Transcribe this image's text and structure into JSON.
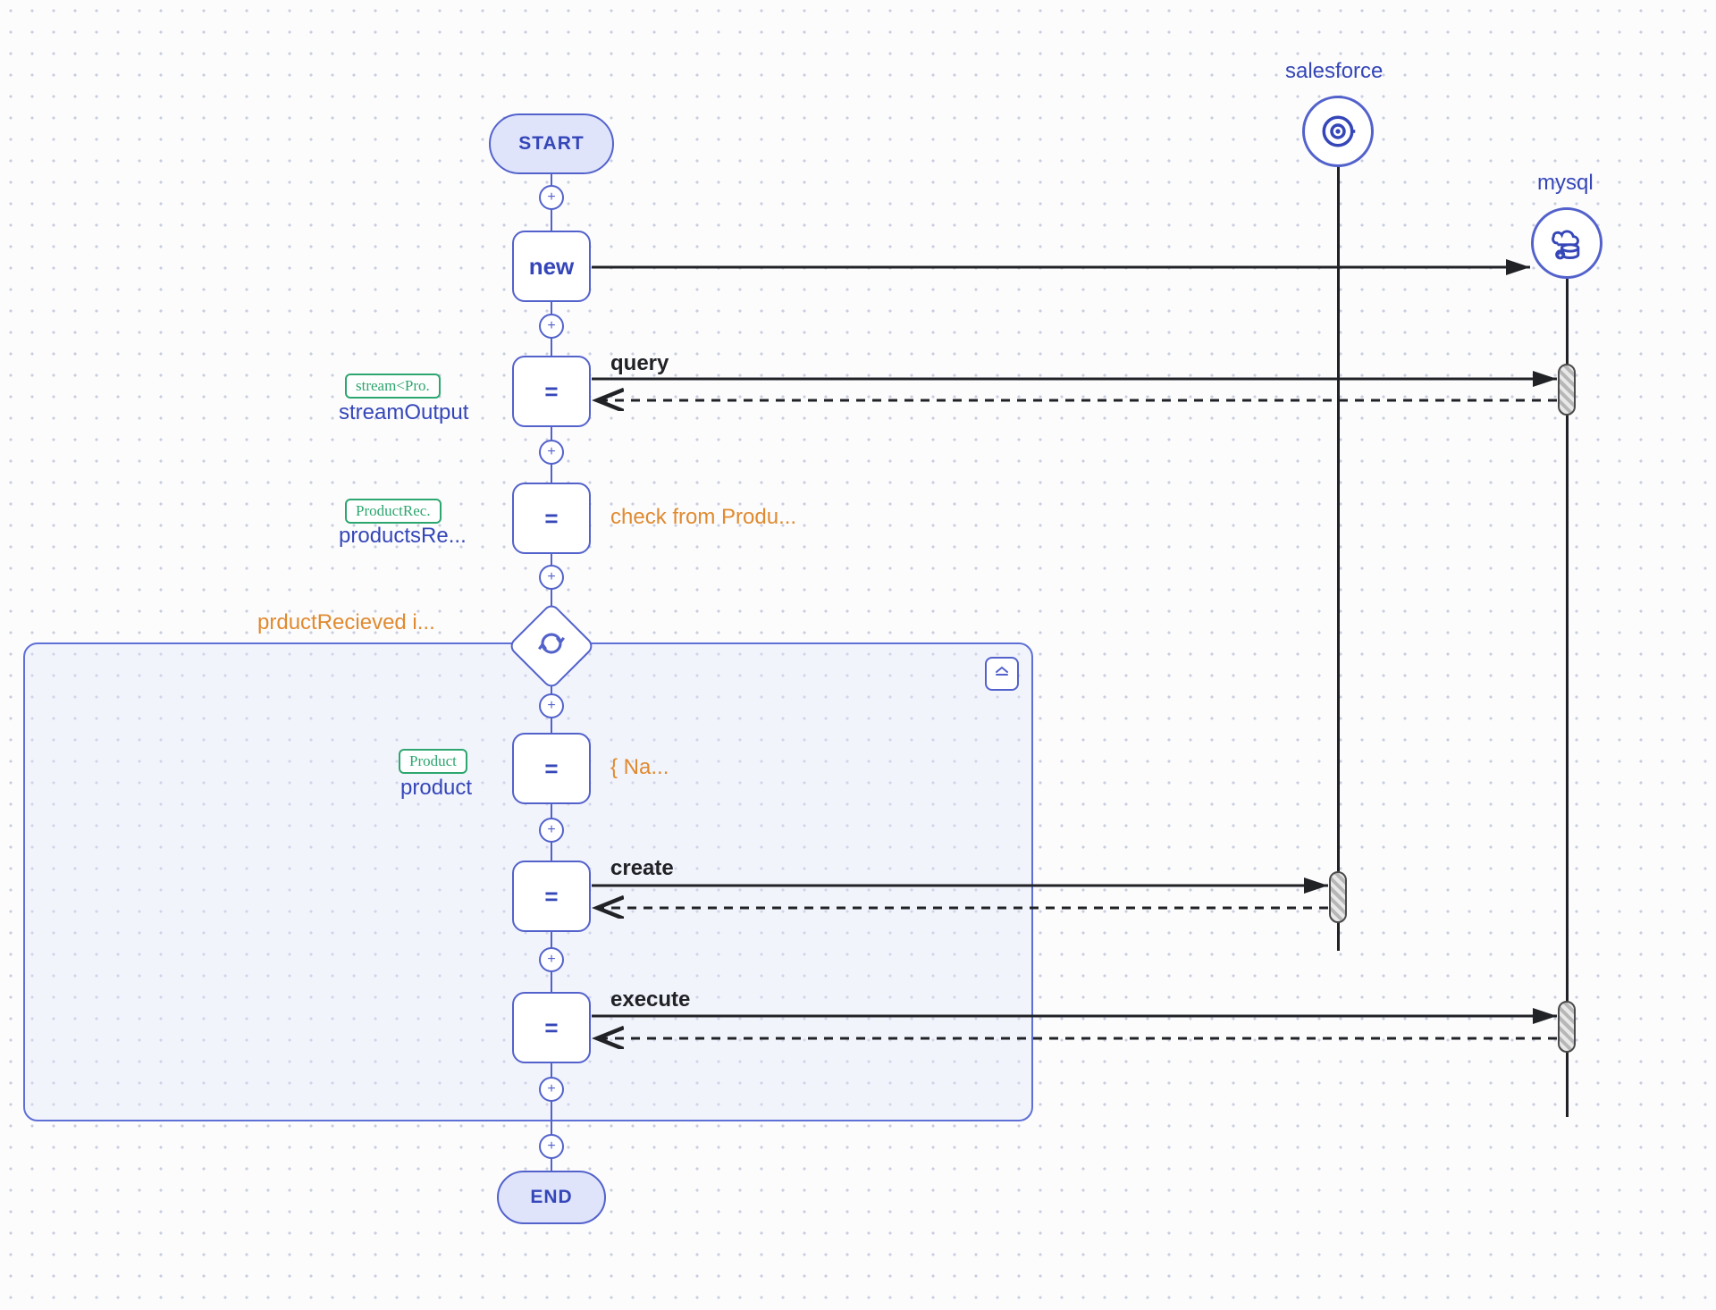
{
  "nodes": {
    "start_label": "START",
    "end_label": "END",
    "new_label": "new",
    "eq1_label": "=",
    "eq2_label": "=",
    "eq3_label": "=",
    "eq4_label": "=",
    "eq5_label": "="
  },
  "types": {
    "stream_tag": "stream<Pro.",
    "product_rec_tag": "ProductRec.",
    "product_tag": "Product"
  },
  "vars": {
    "stream_output": "streamOutput",
    "products_re": "productsRe...",
    "product": "product"
  },
  "actions": {
    "query": "query",
    "create": "create",
    "execute": "execute"
  },
  "orange": {
    "check_from": "check from Produ...",
    "product_recv": "prductRecieved i...",
    "na": "{ Na..."
  },
  "external": {
    "salesforce": "salesforce",
    "mysql": "mysql"
  },
  "icons": {
    "loop": "↻",
    "collapse": "⊻",
    "plus": "+"
  }
}
